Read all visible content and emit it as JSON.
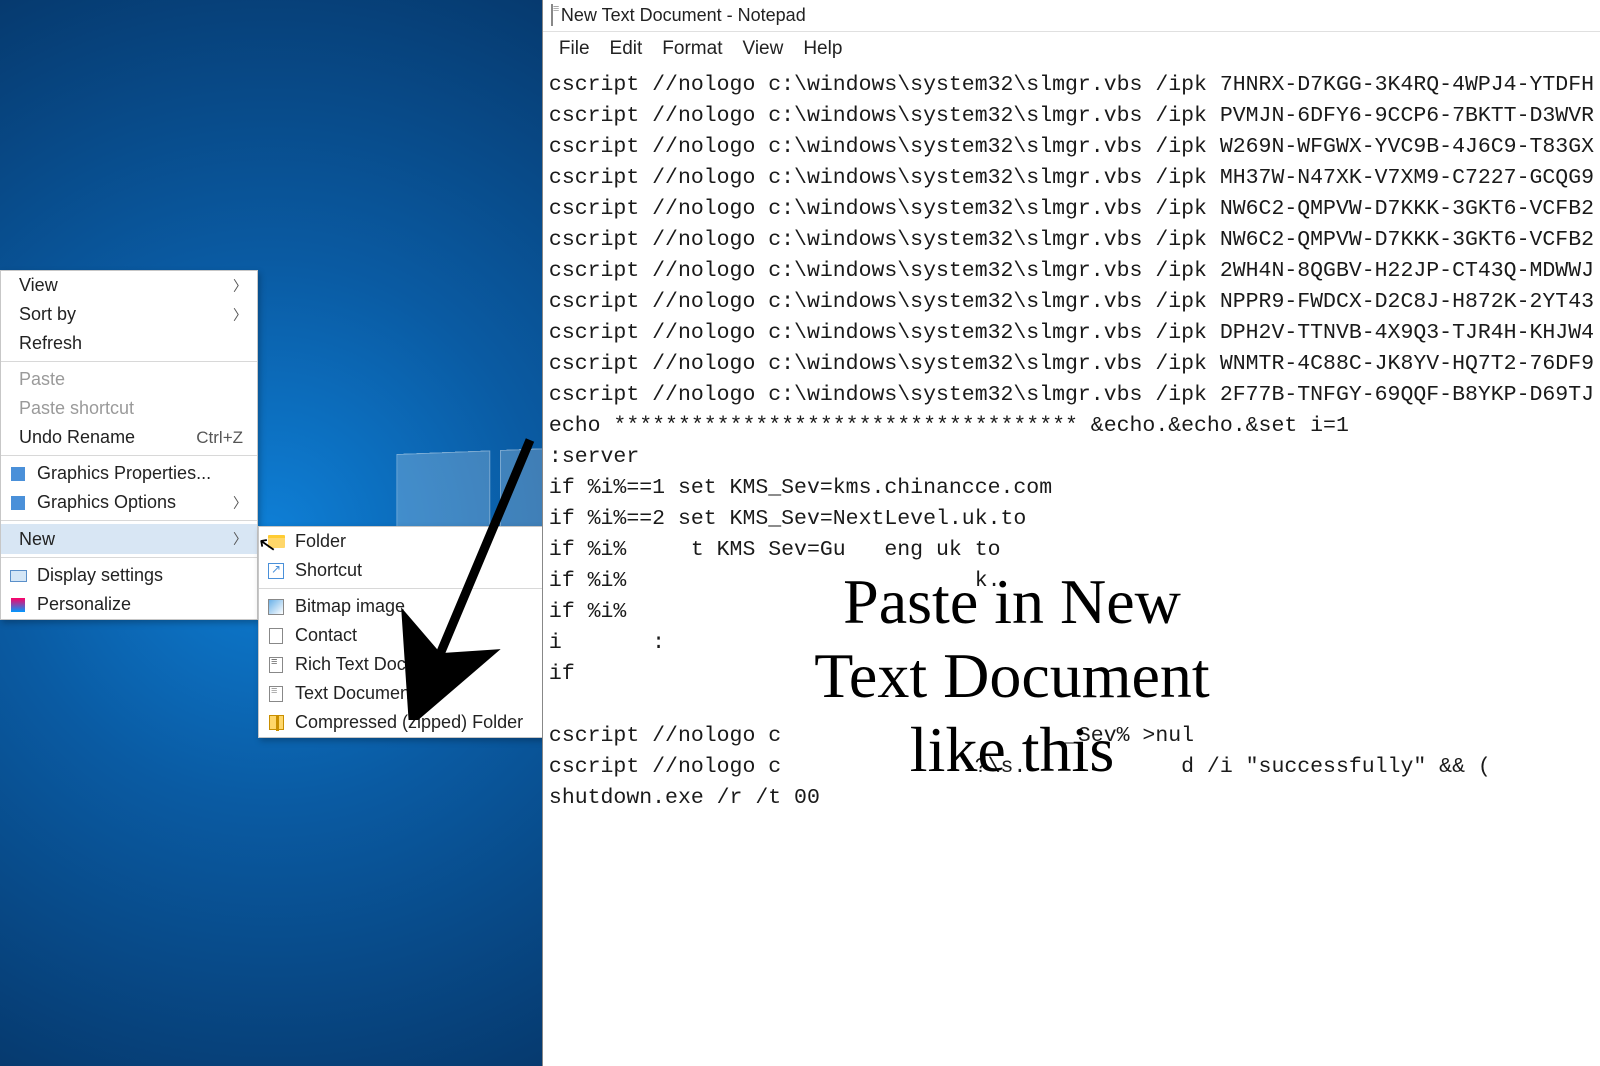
{
  "context_menu": {
    "view": "View",
    "sort": "Sort by",
    "refresh": "Refresh",
    "paste": "Paste",
    "paste_shortcut": "Paste shortcut",
    "undo_rename": "Undo Rename",
    "undo_shortcut": "Ctrl+Z",
    "graphics_props": "Graphics Properties...",
    "graphics_opts": "Graphics Options",
    "new": "New",
    "display_settings": "Display settings",
    "personalize": "Personalize"
  },
  "submenu": {
    "folder": "Folder",
    "shortcut": "Shortcut",
    "bitmap": "Bitmap image",
    "contact": "Contact",
    "rtf": "Rich Text Documer",
    "txt": "Text Document",
    "zip": "Compressed (zipped) Folder"
  },
  "notepad": {
    "title": "New Text Document - Notepad",
    "menu": {
      "file": "File",
      "edit": "Edit",
      "format": "Format",
      "view": "View",
      "help": "Help"
    },
    "lines": [
      "cscript //nologo c:\\windows\\system32\\slmgr.vbs /ipk 7HNRX-D7KGG-3K4RQ-4WPJ4-YTDFH",
      "cscript //nologo c:\\windows\\system32\\slmgr.vbs /ipk PVMJN-6DFY6-9CCP6-7BKTT-D3WVR",
      "cscript //nologo c:\\windows\\system32\\slmgr.vbs /ipk W269N-WFGWX-YVC9B-4J6C9-T83GX",
      "cscript //nologo c:\\windows\\system32\\slmgr.vbs /ipk MH37W-N47XK-V7XM9-C7227-GCQG9",
      "cscript //nologo c:\\windows\\system32\\slmgr.vbs /ipk NW6C2-QMPVW-D7KKK-3GKT6-VCFB2",
      "cscript //nologo c:\\windows\\system32\\slmgr.vbs /ipk NW6C2-QMPVW-D7KKK-3GKT6-VCFB2",
      "cscript //nologo c:\\windows\\system32\\slmgr.vbs /ipk 2WH4N-8QGBV-H22JP-CT43Q-MDWWJ",
      "cscript //nologo c:\\windows\\system32\\slmgr.vbs /ipk NPPR9-FWDCX-D2C8J-H872K-2YT43",
      "cscript //nologo c:\\windows\\system32\\slmgr.vbs /ipk DPH2V-TTNVB-4X9Q3-TJR4H-KHJW4",
      "cscript //nologo c:\\windows\\system32\\slmgr.vbs /ipk WNMTR-4C88C-JK8YV-HQ7T2-76DF9",
      "cscript //nologo c:\\windows\\system32\\slmgr.vbs /ipk 2F77B-TNFGY-69QQF-B8YKP-D69TJ",
      "echo ************************************ &echo.&echo.&set i=1",
      ":server",
      "if %i%==1 set KMS_Sev=kms.chinancce.com",
      "if %i%==2 set KMS_Sev=NextLevel.uk.to",
      "if %i%     t KMS Sev=Gu   eng uk to",
      "if %i%                           k.",
      "if %i%                          ",
      "i       :                     ",
      "if                            ",
      "                              ",
      "cscript //nologo c                      _Sev% >nul",
      "cscript //nologo c               ?\\s.            d /i \"successfully\" && (",
      "shutdown.exe /r /t 00"
    ]
  },
  "annotation": "Paste in New\nText Document\nlike this"
}
